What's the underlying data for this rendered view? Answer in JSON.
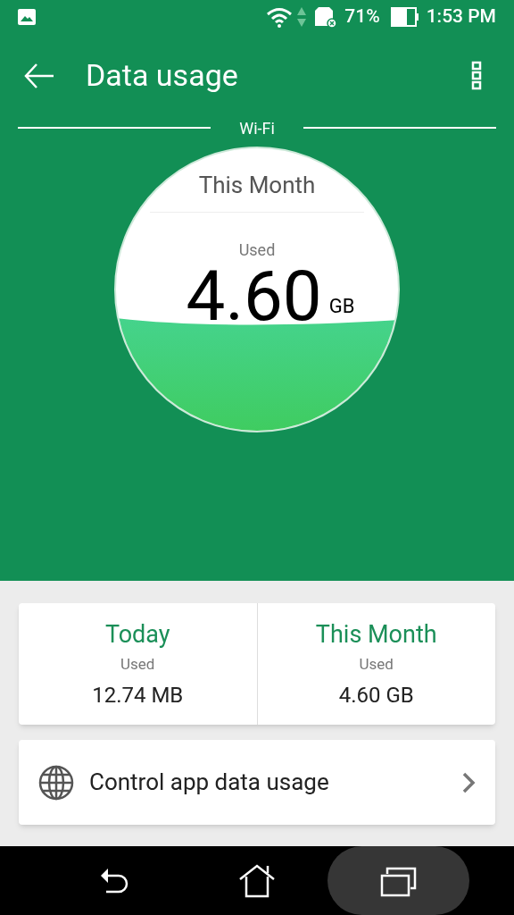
{
  "status_bar": {
    "battery_percent": "71%",
    "time": "1:53 PM"
  },
  "toolbar": {
    "title": "Data usage"
  },
  "network_label": "Wi-Fi",
  "gauge": {
    "period": "This Month",
    "caption": "Used",
    "amount": "4.60",
    "unit": "GB"
  },
  "summary": [
    {
      "title": "Today",
      "caption": "Used",
      "amount": "12.74 MB"
    },
    {
      "title": "This Month",
      "caption": "Used",
      "amount": "4.60 GB"
    }
  ],
  "control_row": {
    "label": "Control app data usage"
  },
  "nav_bar": [
    {
      "kind": "back",
      "selected": false
    },
    {
      "kind": "home",
      "selected": false
    },
    {
      "kind": "recents",
      "selected": true
    }
  ]
}
